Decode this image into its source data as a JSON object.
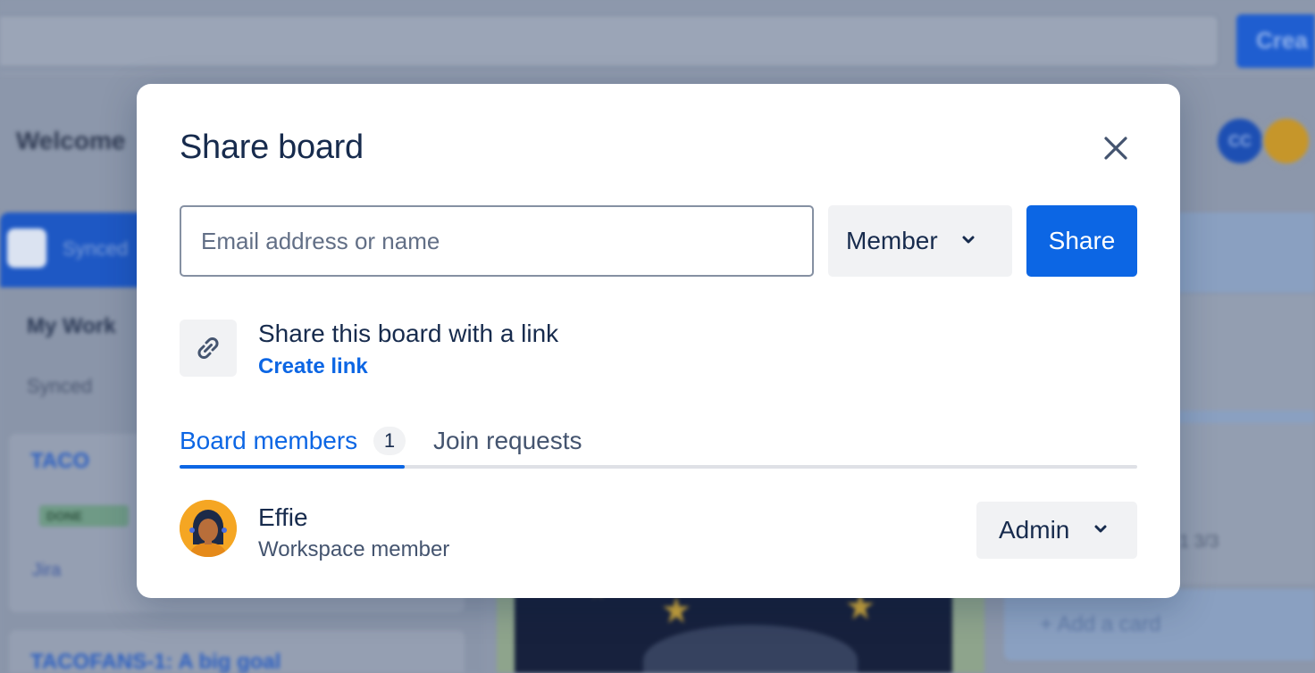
{
  "background": {
    "create_button_label": "Crea",
    "welcome_text": "Welcome",
    "avatar_initials": "CC",
    "sidebar_header_label": "Synced",
    "my_work_label": "My Work",
    "synced_label": "Synced",
    "card1_title": "TACO",
    "card1_status": "DONE",
    "card1_source": "Jira",
    "card2_title": "TACOFANS-1: A big goal",
    "add_card_label": "Add a card",
    "card_meta": "1   3/3"
  },
  "modal": {
    "title": "Share board",
    "email_placeholder": "Email address or name",
    "email_value": "",
    "role_selected": "Member",
    "share_button": "Share",
    "link_title": "Share this board with a link",
    "create_link": "Create link",
    "tabs": [
      {
        "label": "Board members",
        "count": "1",
        "active": true
      },
      {
        "label": "Join requests",
        "active": false
      }
    ],
    "members": [
      {
        "name": "Effie",
        "subtitle": "Workspace member",
        "role": "Admin"
      }
    ]
  },
  "colors": {
    "primary": "#0c66e4",
    "text": "#172b4d",
    "subtle_text": "#44546f",
    "neutral_button": "#f1f2f4",
    "overlay": "#8c97ab"
  },
  "icons": {
    "close": "close-icon",
    "role_chevron": "chevron-down-icon",
    "link": "link-icon",
    "avatar": "avatar-effie"
  }
}
